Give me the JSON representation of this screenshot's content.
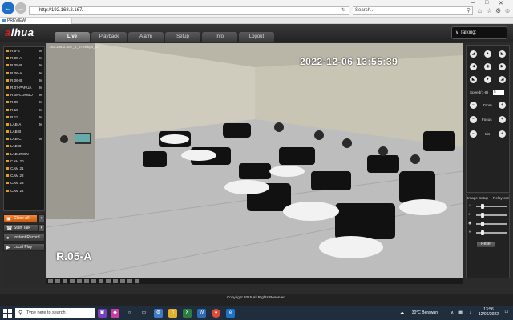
{
  "browser": {
    "address": "http://192.168.2.167/",
    "search_placeholder": "Search...",
    "tab_title": "PREVIEW"
  },
  "app": {
    "logo_prefix": "",
    "logo_a": "a",
    "logo_text": "lhua",
    "menu": [
      "Live",
      "Playback",
      "Alarm",
      "Setup",
      "Info",
      "Logout"
    ],
    "talking": "Talking:",
    "cameras": [
      {
        "name": "R.5-B",
        "m": "M"
      },
      {
        "name": "R.05-A",
        "m": "M"
      },
      {
        "name": "R.05-B",
        "m": "M"
      },
      {
        "name": "R.06-A",
        "m": "M"
      },
      {
        "name": "R.06-B",
        "m": "M"
      },
      {
        "name": "R.07-PAPUA",
        "m": "M"
      },
      {
        "name": "R.08-LOMBO",
        "m": "M"
      },
      {
        "name": "R.09",
        "m": "M"
      },
      {
        "name": "R.10",
        "m": "M"
      },
      {
        "name": "R.11",
        "m": "M"
      },
      {
        "name": "LAB-A",
        "m": "M"
      },
      {
        "name": "LAB-B",
        "m": ""
      },
      {
        "name": "LAB-C",
        "m": "M"
      },
      {
        "name": "LAB-D",
        "m": ""
      },
      {
        "name": "LAB-JRGN",
        "m": ""
      },
      {
        "name": "CAM 20",
        "m": ""
      },
      {
        "name": "CAM 21",
        "m": ""
      },
      {
        "name": "CAM 22",
        "m": ""
      },
      {
        "name": "CAM 23",
        "m": ""
      },
      {
        "name": "CAM 24",
        "m": ""
      }
    ],
    "close_all": "Close All",
    "start_talk": "Start Talk",
    "instant_record": "Instant Record",
    "local_play": "Local Play",
    "video_info": "192.168.2.167_6_976Kbps_M",
    "timestamp": "2022-12-06 13:55:39",
    "room_label": "R.05-A",
    "ptz": {
      "speed_label": "Speed(1-8)",
      "speed_value": "5",
      "zoom": "Zoom",
      "focus": "Focus",
      "iris": "Iris"
    },
    "image_setup": "Image Setup",
    "relay_out": "Relay-out",
    "reset": "Reset",
    "copyright": "Copyright 2015,All Rights Reserved."
  },
  "taskbar": {
    "search_placeholder": "Type here to search",
    "weather": "30°C  Berawan",
    "time": "13:56",
    "date": "12/06/2022"
  }
}
